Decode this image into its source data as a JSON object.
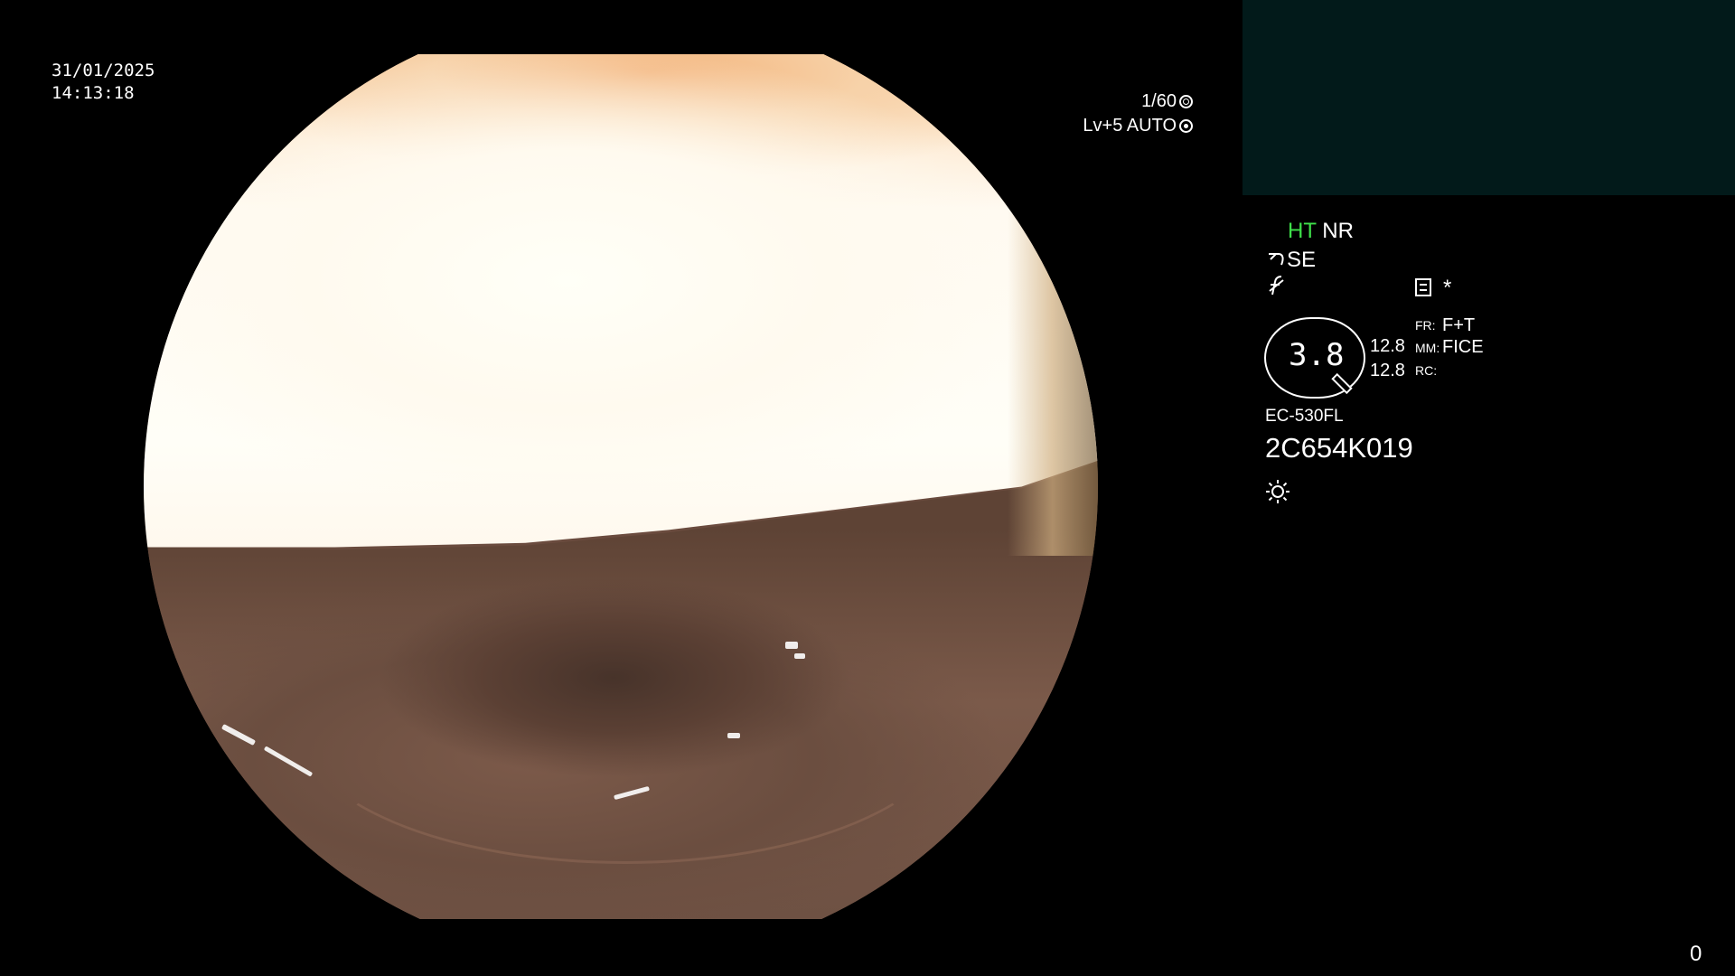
{
  "header": {
    "date": "31/01/2025",
    "time": "14:13:18",
    "shutter": "1/60",
    "level": "Lv+5 AUTO"
  },
  "status_panel": {
    "ht": "HT",
    "nr": "NR",
    "se": "SE",
    "f_symbol": "f",
    "star": "*",
    "zoom": "3.8",
    "value_1": "12.8",
    "value_2": "12.8",
    "fr_label": "FR:",
    "fr_value": "F+T",
    "mm_label": "MM:",
    "mm_value": "FICE",
    "rc_label": "RC:",
    "scope_model": "EC-530FL",
    "serial": "2C654K019"
  },
  "footer": {
    "counter": "0"
  },
  "icons": {
    "shutter": "shutter-icon",
    "auto": "target-icon",
    "scope_tip": "scope-tip-icon",
    "f": "f-icon",
    "doc": "document-icon",
    "light": "sun-icon"
  },
  "colors": {
    "background": "#000000",
    "thumb_panel": "#021a1a",
    "ht_active": "#3ee04a",
    "text": "#ffffff"
  }
}
